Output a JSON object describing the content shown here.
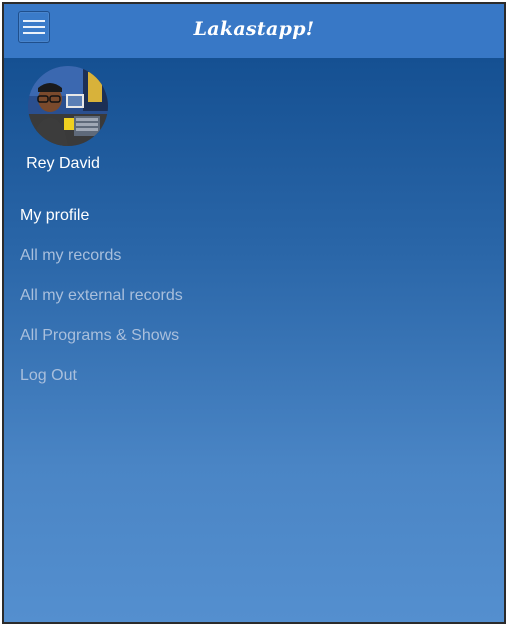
{
  "header": {
    "title": "Lakastapp!",
    "menu_icon": "hamburger-menu-icon"
  },
  "profile": {
    "name": "Rey David",
    "avatar_icon": "user-avatar"
  },
  "menu": {
    "items": [
      {
        "label": "My profile",
        "active": true
      },
      {
        "label": "All my records",
        "active": false
      },
      {
        "label": "All my external records",
        "active": false
      },
      {
        "label": "All Programs & Shows",
        "active": false
      },
      {
        "label": "Log Out",
        "active": false
      }
    ]
  },
  "colors": {
    "topbar": "#3878c6",
    "gradient_top": "#0f4a8c",
    "gradient_bottom": "#548fcf",
    "active_text": "#ffffff",
    "inactive_text": "#a9bfdc"
  }
}
